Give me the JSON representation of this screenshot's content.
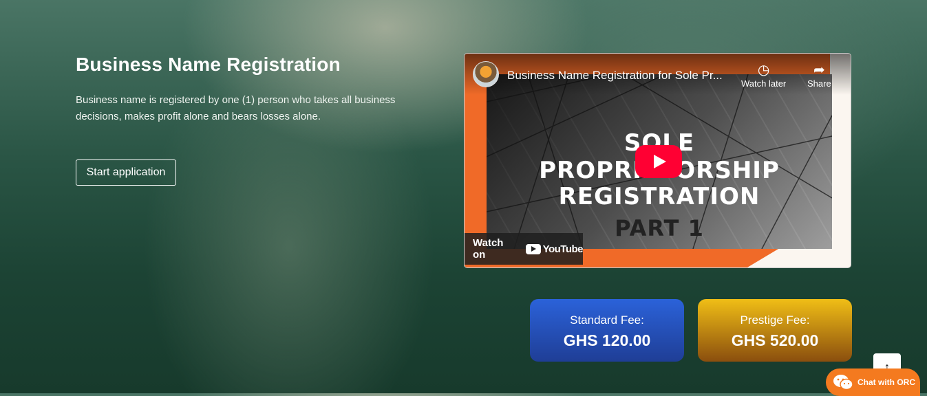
{
  "hero": {
    "title": "Business Name Registration",
    "description": "Business name is registered by one (1) person who takes all business decisions, makes profit alone and bears losses alone.",
    "start_button": "Start application"
  },
  "video": {
    "title": "Business Name Registration for Sole Pr...",
    "watch_later": "Watch later",
    "share": "Share",
    "thumbnail_lines": [
      "SOLE",
      "PROPRIETORSHIP",
      "REGISTRATION",
      "PART 1"
    ],
    "watch_on": "Watch on",
    "platform": "YouTube"
  },
  "fees": {
    "standard": {
      "label": "Standard Fee:",
      "amount": "GHS 120.00"
    },
    "prestige": {
      "label": "Prestige Fee:",
      "amount": "GHS 520.00"
    }
  },
  "chat": {
    "label": "Chat with ORC"
  },
  "icons": {
    "scroll_top": "arrow-up-icon",
    "chat": "wechat-icon",
    "watch_later": "clock-icon",
    "share": "share-icon",
    "play": "play-icon"
  },
  "colors": {
    "standard_fee": "#2b62d9",
    "prestige_fee": "#f0be16",
    "chat_button": "#f47a1f",
    "youtube_red": "#ff0033"
  }
}
